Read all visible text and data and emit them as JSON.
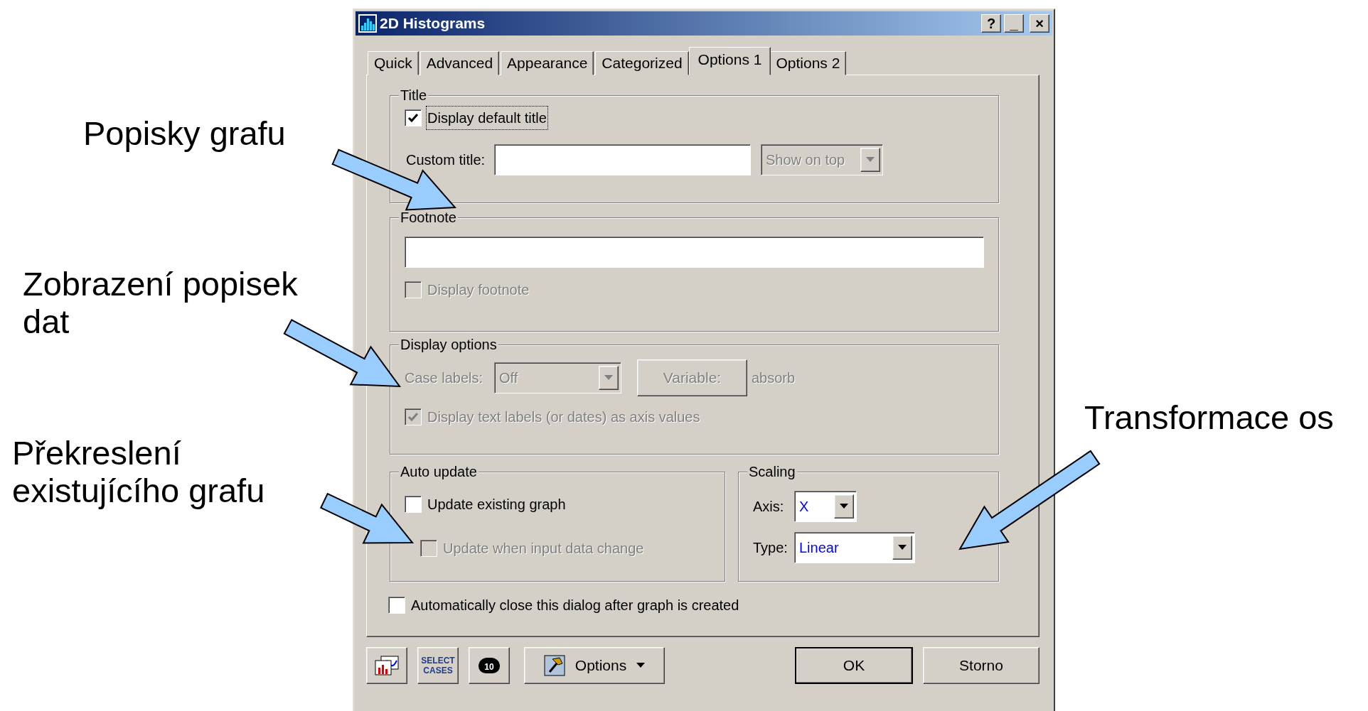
{
  "annotations": [
    {
      "text": "Popisky grafu"
    },
    {
      "text": "Zobrazení popisek dat"
    },
    {
      "text": "Překreslení existujícího grafu"
    },
    {
      "text": "Transformace os"
    }
  ],
  "window": {
    "title": "2D Histograms",
    "buttons": [
      "?",
      "_",
      "×"
    ]
  },
  "tabs": [
    {
      "label": "Quick",
      "selected": false
    },
    {
      "label": "Advanced",
      "selected": false
    },
    {
      "label": "Appearance",
      "selected": false
    },
    {
      "label": "Categorized",
      "selected": false
    },
    {
      "label": "Options 1",
      "selected": true
    },
    {
      "label": "Options 2",
      "selected": false
    }
  ],
  "title_group": {
    "legend": "Title",
    "display_default": {
      "label": "Display default title",
      "checked": true,
      "disabled": false
    },
    "custom_title": {
      "label": "Custom title:"
    },
    "position": {
      "value": "Show on top",
      "disabled": true
    }
  },
  "footnote_group": {
    "legend": "Footnote",
    "display_footnote": {
      "label": "Display footnote",
      "checked": false,
      "disabled": true
    }
  },
  "display_options": {
    "legend": "Display options",
    "case_labels": {
      "label": "Case labels:",
      "value": "Off",
      "disabled": true
    },
    "variable_button": {
      "label": "Variable:",
      "disabled": true
    },
    "variable_value": "absorb",
    "text_labels": {
      "label": "Display text labels (or dates) as axis values",
      "checked": true,
      "disabled": true
    }
  },
  "auto_update": {
    "legend": "Auto update",
    "options": [
      {
        "label": "Update existing graph",
        "checked": false,
        "disabled": false
      },
      {
        "label": "Update when input data change",
        "checked": false,
        "disabled": true
      }
    ]
  },
  "scaling": {
    "legend": "Scaling",
    "fields": [
      {
        "label": "Axis:",
        "value": "X"
      },
      {
        "label": "Type:",
        "value": "Linear"
      }
    ]
  },
  "auto_close": {
    "label": "Automatically close this dialog after graph is created",
    "checked": false,
    "disabled": false
  },
  "toolbar": {
    "select_cases": [
      "SELECT",
      "CASES"
    ],
    "by_group": "10",
    "options": "Options"
  },
  "buttons": [
    "OK",
    "Storno"
  ]
}
